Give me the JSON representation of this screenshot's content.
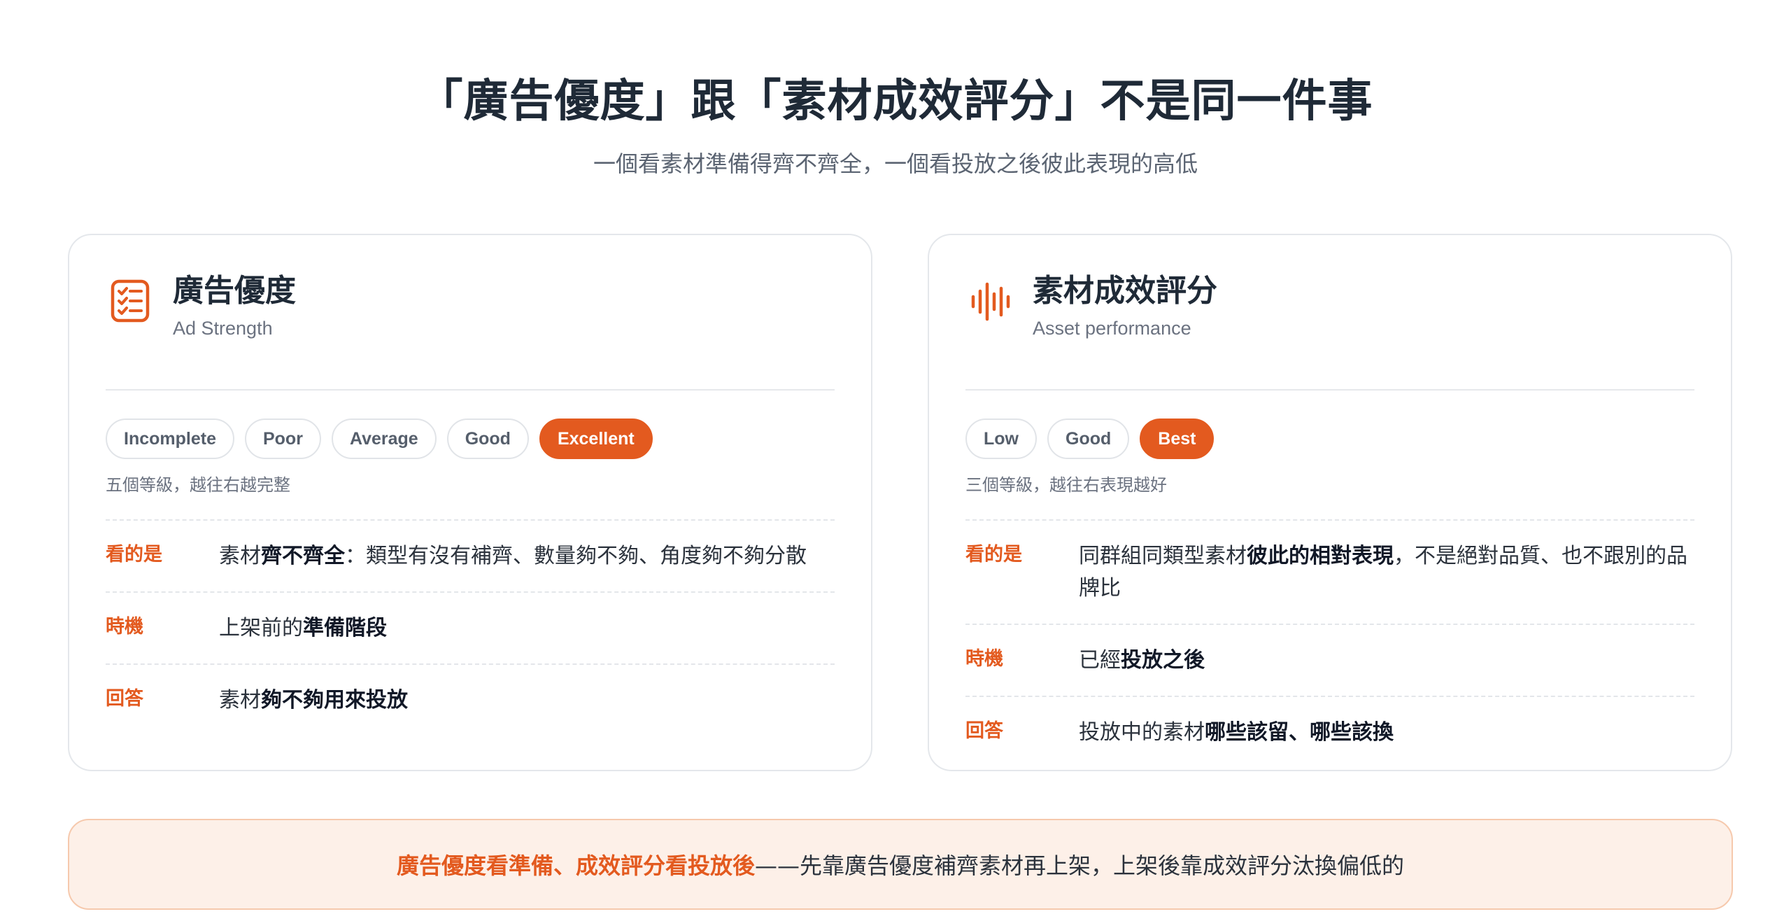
{
  "header": {
    "title": "「廣告優度」跟「素材成效評分」不是同一件事",
    "subtitle": "一個看素材準備得齊不齊全，一個看投放之後彼此表現的高低"
  },
  "accent_color": "#e35a1f",
  "cards": [
    {
      "icon": "checklist-icon",
      "title": "廣告優度",
      "subtitle": "Ad Strength",
      "levels": [
        "Incomplete",
        "Poor",
        "Average",
        "Good",
        "Excellent"
      ],
      "active_level": "Excellent",
      "levels_note": "五個等級，越往右越完整",
      "rows": [
        {
          "label": "看的是",
          "parts": [
            "素材",
            "齊不齊全",
            "：類型有沒有補齊、數量夠不夠、角度夠不夠分散"
          ]
        },
        {
          "label": "時機",
          "parts": [
            "上架前的",
            "準備階段",
            ""
          ]
        },
        {
          "label": "回答",
          "parts": [
            "素材",
            "夠不夠用來投放",
            ""
          ]
        }
      ]
    },
    {
      "icon": "audio-bars-icon",
      "title": "素材成效評分",
      "subtitle": "Asset performance",
      "levels": [
        "Low",
        "Good",
        "Best"
      ],
      "active_level": "Best",
      "levels_note": "三個等級，越往右表現越好",
      "rows": [
        {
          "label": "看的是",
          "parts": [
            "同群組同類型素材",
            "彼此的相對表現",
            "，不是絕對品質、也不跟別的品牌比"
          ]
        },
        {
          "label": "時機",
          "parts": [
            "已經",
            "投放之後",
            ""
          ]
        },
        {
          "label": "回答",
          "parts": [
            "投放中的素材",
            "哪些該留、哪些該換",
            ""
          ]
        }
      ]
    }
  ],
  "banner": {
    "hl1": "廣告優度看準備",
    "sep": "、",
    "hl2": "成效評分看投放後",
    "rest": "——先靠廣告優度補齊素材再上架，上架後靠成效評分汰換偏低的"
  }
}
